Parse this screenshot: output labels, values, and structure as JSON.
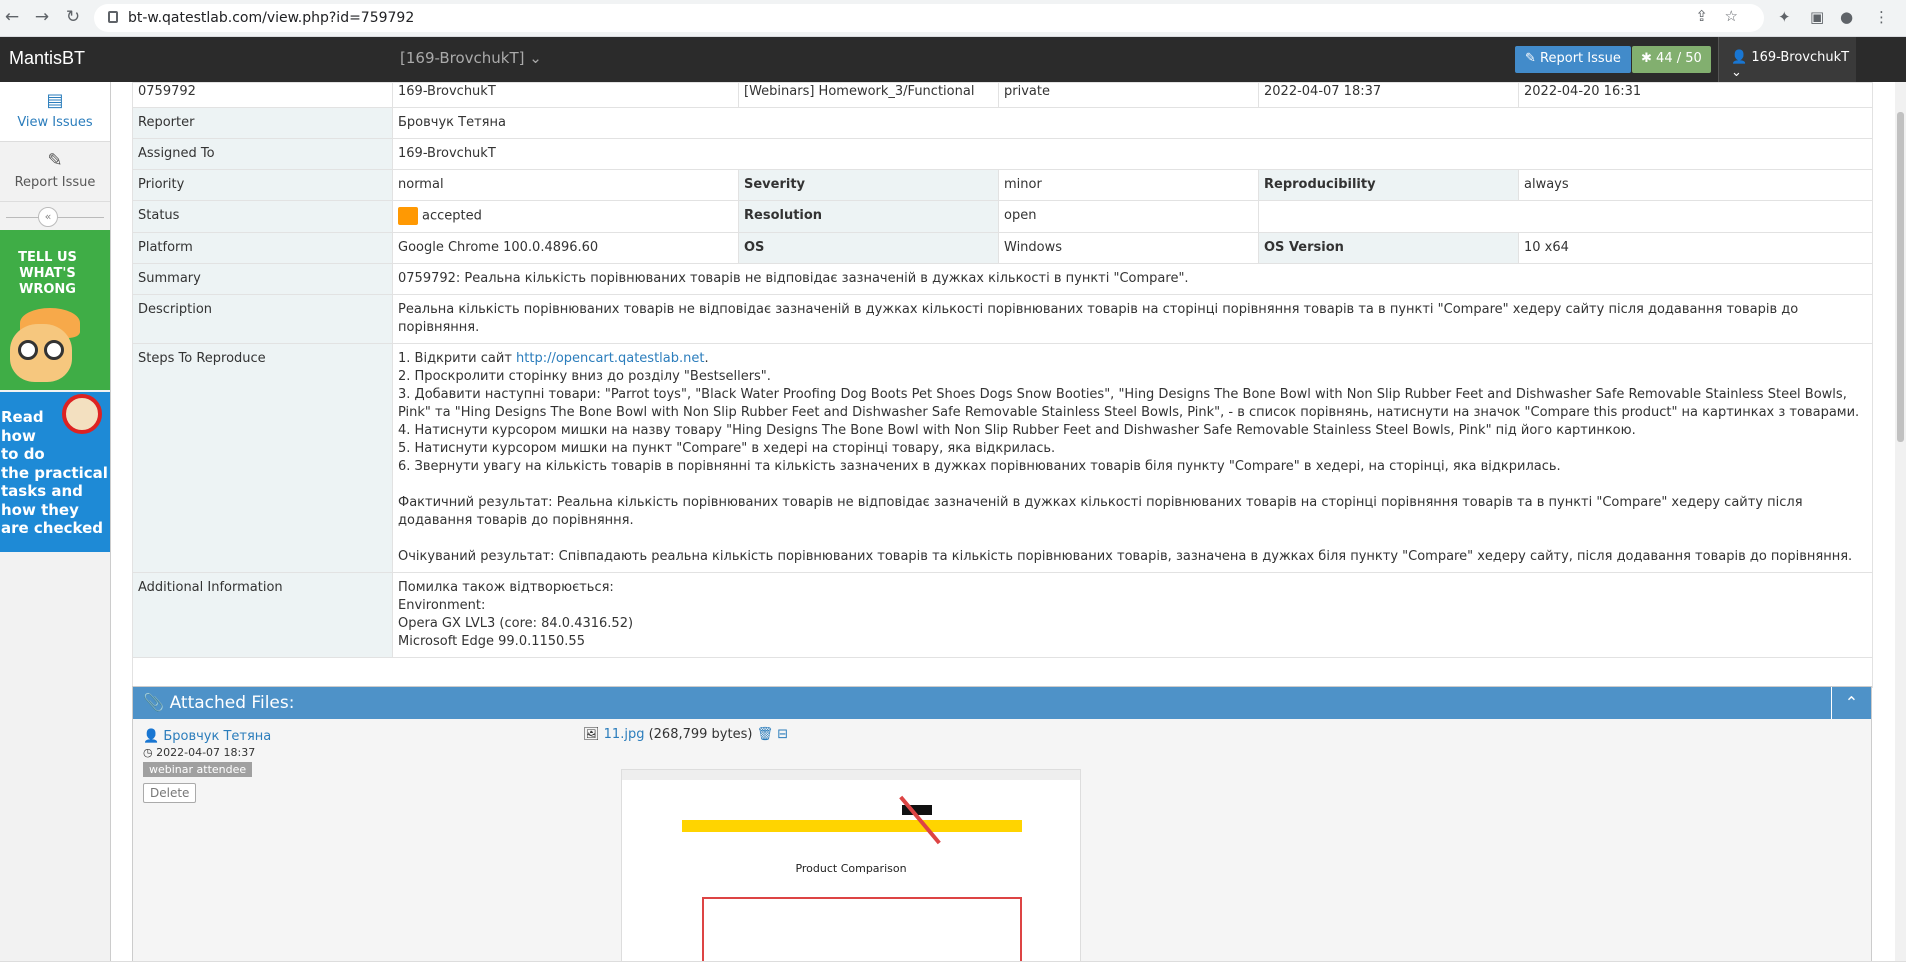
{
  "browser": {
    "url": "bt-w.qatestlab.com/view.php?id=759792"
  },
  "navbar": {
    "brand": "MantisBT",
    "project": "[169-BrovchukT]",
    "report_issue": "Report Issue",
    "issue_count": "44 / 50",
    "user": "169-BrovchukT"
  },
  "sidebar": {
    "items": [
      {
        "label": "View Issues",
        "icon": "list-icon"
      },
      {
        "label": "Report Issue",
        "icon": "edit-icon"
      }
    ],
    "ad1": "TELL US WHAT'S WRONG",
    "ad2": [
      "Read",
      "how",
      "to do",
      "the practical",
      "tasks and",
      "how they",
      "are checked"
    ]
  },
  "issue": {
    "id": "0759792",
    "project": "169-BrovchukT",
    "category": "[Webinars] Homework_3/Functional",
    "view_status": "private",
    "date_submitted": "2022-04-07 18:37",
    "last_update": "2022-04-20 16:31",
    "reporter_label": "Reporter",
    "reporter": "Бровчук Тетяна",
    "assigned_label": "Assigned To",
    "assigned": "169-BrovchukT",
    "priority_label": "Priority",
    "priority": "normal",
    "severity_label": "Severity",
    "severity": "minor",
    "repro_label": "Reproducibility",
    "repro": "always",
    "status_label": "Status",
    "status": "accepted",
    "status_color": "#ff9903",
    "resolution_label": "Resolution",
    "resolution": "open",
    "platform_label": "Platform",
    "platform": "Google Chrome 100.0.4896.60",
    "os_label": "OS",
    "os": "Windows",
    "osver_label": "OS Version",
    "osver": "10 x64",
    "summary_label": "Summary",
    "summary": "0759792: Реальна кількість порівнюваних товарів не відповідає зазначеній в дужках кількості в пункті \"Compare\".",
    "description_label": "Description",
    "description": "Реальна кількість порівнюваних товарів не відповідає зазначеній в дужках кількості порівнюваних товарів на сторінці порівняння товарів та в пункті \"Compare\" хедеру сайту після додавання товарів до порівняння.",
    "steps_label": "Steps To Reproduce",
    "steps": {
      "s1_prefix": "1. Відкрити сайт ",
      "s1_link": "http://opencart.qatestlab.net",
      "s1_suffix": ".",
      "s2": "2. Проскролити сторінку вниз до розділу \"Bestsellers\".",
      "s3": "3. Добавити наступні товари: \"Parrot toys\", \"Black Water Proofing Dog Boots Pet Shoes Dogs Snow Booties\", \"Hing Designs The Bone Bowl with Non Slip Rubber Feet and Dishwasher Safe Removable Stainless Steel Bowls, Pink\" та \"Hing Designs The Bone Bowl with Non Slip Rubber Feet and Dishwasher Safe Removable Stainless Steel Bowls, Pink\", - в список порівнянь, натиснути на значок \"Compare this product\" на картинках з товарами.",
      "s4": "4. Натиснути курсором мишки на назву товару \"Hing Designs The Bone Bowl with Non Slip Rubber Feet and Dishwasher Safe Removable Stainless Steel Bowls, Pink\" під його картинкою.",
      "s5": "5. Натиснути курсором мишки на пункт \"Compare\" в хедері на сторінці товару, яка відкрилась.",
      "s6": "6. Звернути увагу на кількість товарів в порівнянні та кількість зазначених в дужках порівнюваних товарів біля пункту \"Compare\" в хедері, на сторінці, яка відкрилась.",
      "actual": "Фактичний результат: Реальна кількість порівнюваних товарів не відповідає зазначеній в дужках кількості порівнюваних товарів на сторінці порівняння товарів та в пункті \"Compare\" хедеру сайту після додавання товарів до порівняння.",
      "expected": "Очікуваний результат: Співпадають реальна кількість порівнюваних товарів та кількість порівнюваних товарів, зазначена в дужках біля пункту \"Compare\" хедеру сайту, після додавання товарів до порівняння."
    },
    "addinfo_label": "Additional Information",
    "addinfo": [
      "Помилка також відтворюється:",
      "Environment:",
      "Opera GX LVL3 (core: 84.0.4316.52)",
      "Microsoft Edge 99.0.1150.55"
    ]
  },
  "attachments": {
    "title": "Attached Files:",
    "author": "Бровчук Тетяна",
    "date": "2022-04-07 18:37",
    "badge": "webinar attendee",
    "delete": "Delete",
    "file_name": "11.jpg",
    "file_size": "(268,799 bytes)",
    "thumb_title": "Product Comparison"
  }
}
